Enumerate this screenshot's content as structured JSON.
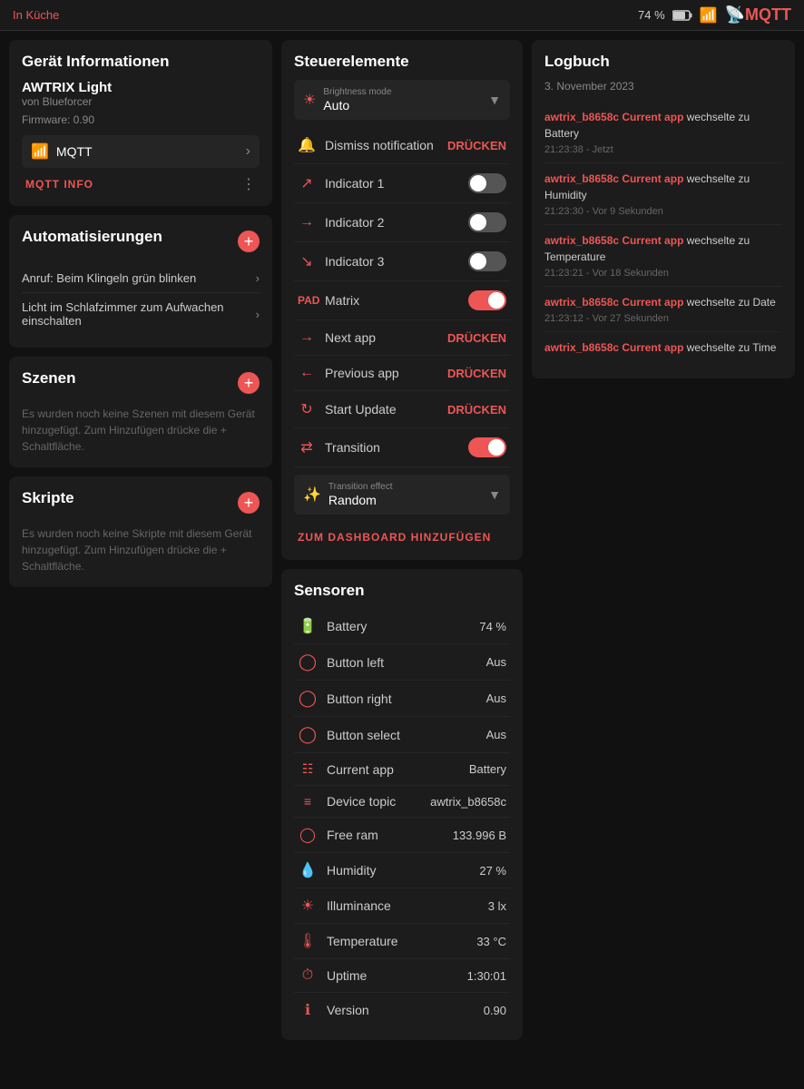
{
  "topbar": {
    "location": "In Küche",
    "battery_pct": "74 %",
    "mqtt_label": "MQTT"
  },
  "left": {
    "device_info": {
      "title": "Gerät Informationen",
      "name": "AWTRIX Light",
      "maker": "von Blueforcer",
      "firmware": "Firmware: 0.90"
    },
    "mqtt": {
      "label": "MQTT",
      "info_btn": "MQTT INFO"
    },
    "automations": {
      "title": "Automatisierungen",
      "items": [
        {
          "text": "Anruf: Beim Klingeln grün blinken"
        },
        {
          "text": "Licht im Schlafzimmer zum Aufwachen einschalten"
        }
      ]
    },
    "scenes": {
      "title": "Szenen",
      "empty_text": "Es wurden noch keine Szenen mit diesem Gerät hinzugefügt. Zum Hinzufügen drücke die + Schaltfläche."
    },
    "scripts": {
      "title": "Skripte",
      "empty_text": "Es wurden noch keine Skripte mit diesem Gerät hinzugefügt. Zum Hinzufügen drücke die + Schaltfläche."
    }
  },
  "middle": {
    "steuerelemente": {
      "title": "Steuerelemente",
      "brightness_label": "Brightness mode",
      "brightness_value": "Auto",
      "controls": [
        {
          "icon": "🔔",
          "label": "Dismiss notification",
          "type": "button",
          "value": "DRÜCKEN"
        },
        {
          "icon": "↗",
          "label": "Indicator 1",
          "type": "toggle",
          "on": false
        },
        {
          "icon": "→",
          "label": "Indicator 2",
          "type": "toggle",
          "on": false
        },
        {
          "icon": "↘",
          "label": "Indicator 3",
          "type": "toggle",
          "on": false
        },
        {
          "icon": "⊞",
          "label": "Matrix",
          "type": "toggle",
          "on": true
        },
        {
          "icon": "→",
          "label": "Next app",
          "type": "button",
          "value": "DRÜCKEN"
        },
        {
          "icon": "←",
          "label": "Previous app",
          "type": "button",
          "value": "DRÜCKEN"
        },
        {
          "icon": "⟳",
          "label": "Start Update",
          "type": "button",
          "value": "DRÜCKEN"
        },
        {
          "icon": "⇄",
          "label": "Transition",
          "type": "toggle",
          "on": true
        }
      ],
      "transition_effect_label": "Transition effect",
      "transition_effect_value": "Random",
      "add_dashboard_btn": "ZUM DASHBOARD HINZUFÜGEN"
    },
    "sensoren": {
      "title": "Sensoren",
      "items": [
        {
          "icon": "🔋",
          "name": "Battery",
          "value": "74 %"
        },
        {
          "icon": "◯",
          "name": "Button left",
          "value": "Aus"
        },
        {
          "icon": "◯",
          "name": "Button right",
          "value": "Aus"
        },
        {
          "icon": "◯",
          "name": "Button select",
          "value": "Aus"
        },
        {
          "icon": "⊞",
          "name": "Current app",
          "value": "Battery"
        },
        {
          "icon": "≡",
          "name": "Device topic",
          "value": "awtrix_b8658c"
        },
        {
          "icon": "⊙",
          "name": "Free ram",
          "value": "133.996 B"
        },
        {
          "icon": "💧",
          "name": "Humidity",
          "value": "27 %"
        },
        {
          "icon": "☀",
          "name": "Illuminance",
          "value": "3 lx"
        },
        {
          "icon": "🌡",
          "name": "Temperature",
          "value": "33 °C"
        },
        {
          "icon": "⏱",
          "name": "Uptime",
          "value": "1:30:01"
        },
        {
          "icon": "ℹ",
          "name": "Version",
          "value": "0.90"
        }
      ]
    }
  },
  "right": {
    "logbuch": {
      "title": "Logbuch",
      "date": "3. November 2023",
      "entries": [
        {
          "prefix": "awtrix_b8658c Current app",
          "text": " wechselte zu Battery",
          "time": "21:23:38 - Jetzt"
        },
        {
          "prefix": "awtrix_b8658c Current app",
          "text": " wechselte zu Humidity",
          "time": "21:23:30 - Vor 9 Sekunden"
        },
        {
          "prefix": "awtrix_b8658c Current app",
          "text": " wechselte zu Temperature",
          "time": "21:23:21 - Vor 18 Sekunden"
        },
        {
          "prefix": "awtrix_b8658c Current app",
          "text": " wechselte zu Date",
          "time": "21:23:12 - Vor 27 Sekunden"
        },
        {
          "prefix": "awtrix_b8658c Current app",
          "text": " wechselte zu Time",
          "time": ""
        }
      ]
    }
  }
}
